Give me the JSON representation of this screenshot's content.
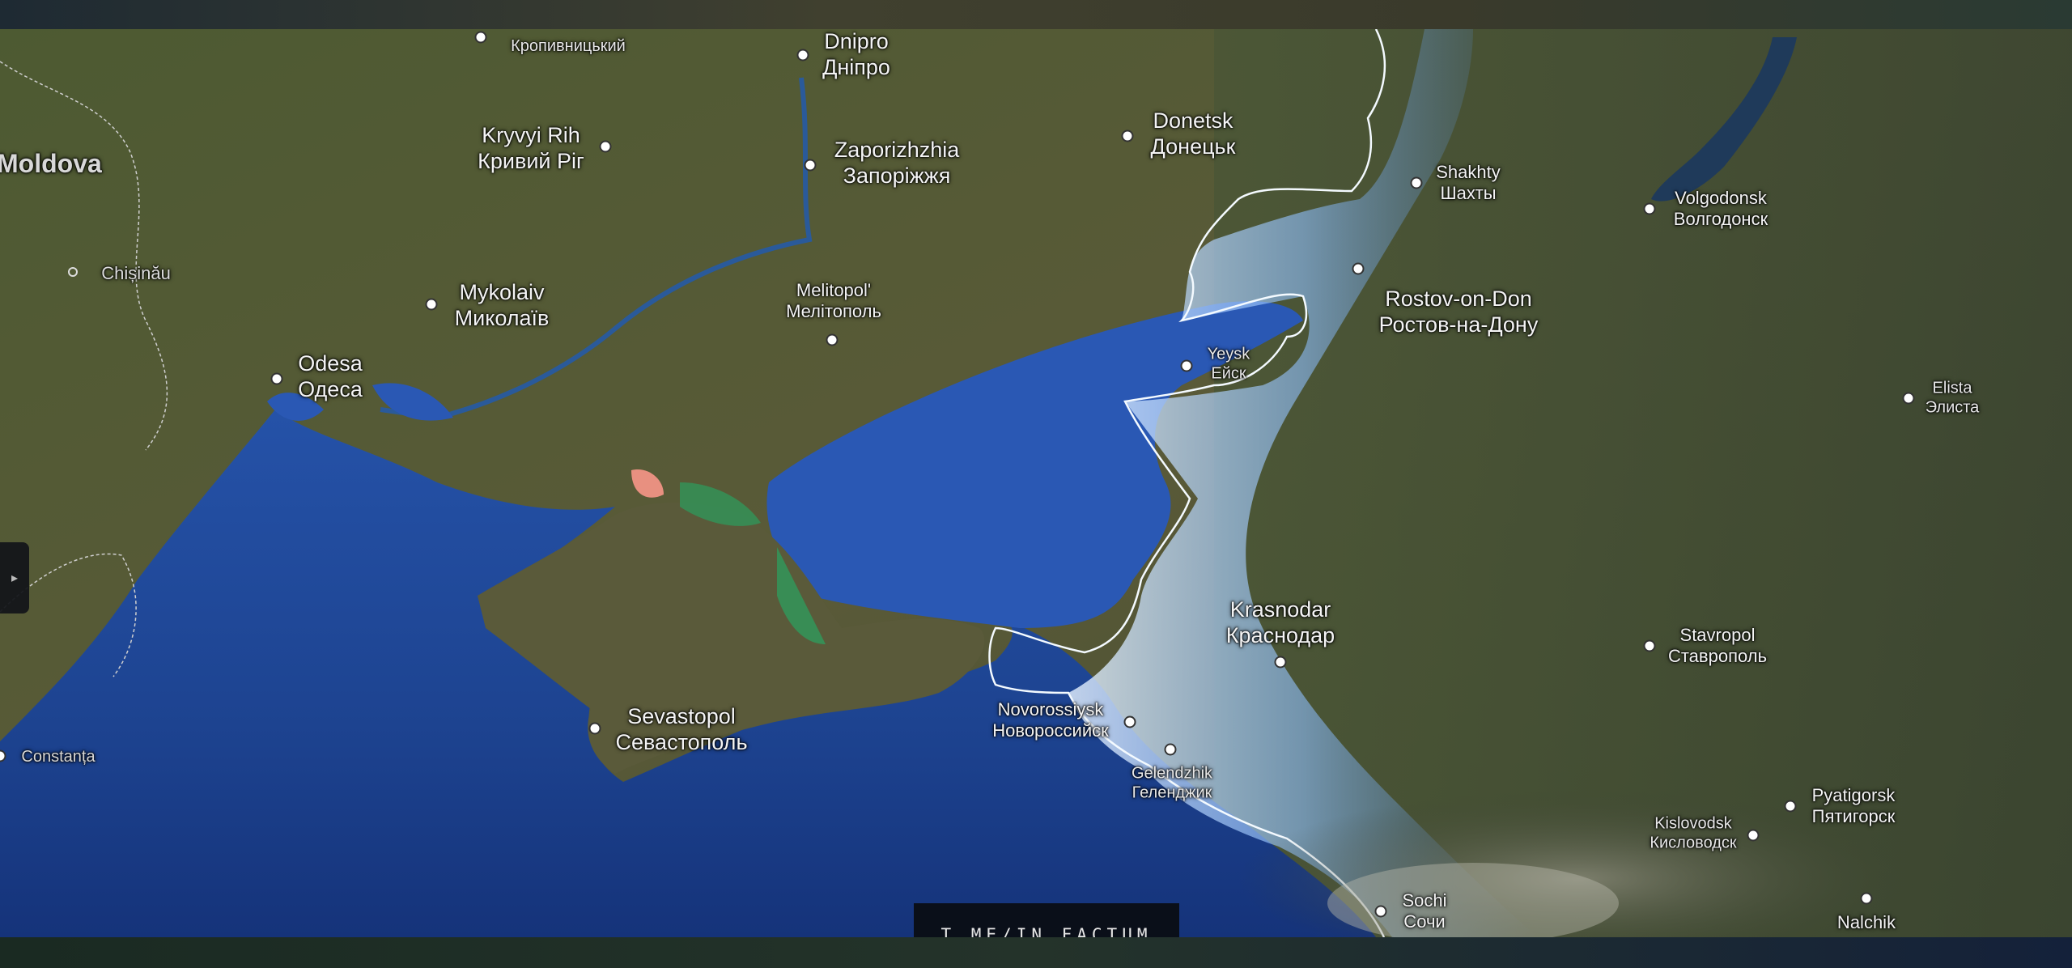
{
  "watermark": "T.ME/IN_FACTUM",
  "country_label": "Moldova",
  "toggle_icon": "▸",
  "places": {
    "kropyvnytskyi": "Кропивницький",
    "dnipro_en": "Dnipro",
    "dnipro_uk": "Дніпро",
    "kryvyi_en": "Kryvyi Rih",
    "kryvyi_uk": "Кривий Ріг",
    "zaporizhzhia_en": "Zaporizhzhia",
    "zaporizhzhia_uk": "Запоріжжя",
    "donetsk_en": "Donetsk",
    "donetsk_uk": "Донецьк",
    "shakhty_en": "Shakhty",
    "shakhty_ru": "Шахты",
    "volgodonsk_en": "Volgodonsk",
    "volgodonsk_ru": "Волгодонск",
    "chisinau": "Chișinău",
    "mykolaiv_en": "Mykolaiv",
    "mykolaiv_uk": "Миколаїв",
    "melitopol_en": "Melitopol'",
    "melitopol_uk": "Мелітополь",
    "rostov_en": "Rostov-on-Don",
    "rostov_ru": "Ростов-на-Дону",
    "odesa_en": "Odesa",
    "odesa_uk": "Одеса",
    "yeysk_en": "Yeysk",
    "yeysk_ru": "Ейск",
    "elista_en": "Elista",
    "elista_ru": "Элиста",
    "krasnodar_en": "Krasnodar",
    "krasnodar_ru": "Краснодар",
    "stavropol_en": "Stavropol",
    "stavropol_ru": "Ставрополь",
    "novorossiysk_en": "Novorossiysk",
    "novorossiysk_ru": "Новороссийск",
    "sevastopol_en": "Sevastopol",
    "sevastopol_uk": "Севастополь",
    "constanta": "Constanța",
    "gelendzhik_en": "Gelendzhik",
    "gelendzhik_ru": "Геленджик",
    "pyatigorsk_en": "Pyatigorsk",
    "pyatigorsk_ru": "Пятигорск",
    "kislovodsk_en": "Kislovodsk",
    "kislovodsk_ru": "Кисловодск",
    "sochi_en": "Sochi",
    "sochi_ru": "Сочи",
    "nalchik": "Nalchik"
  },
  "colors": {
    "sea": "#1f4a9a",
    "land": "#4a5a34",
    "highlight": "#9ec9ff",
    "accent_green": "#2f9a5c"
  }
}
